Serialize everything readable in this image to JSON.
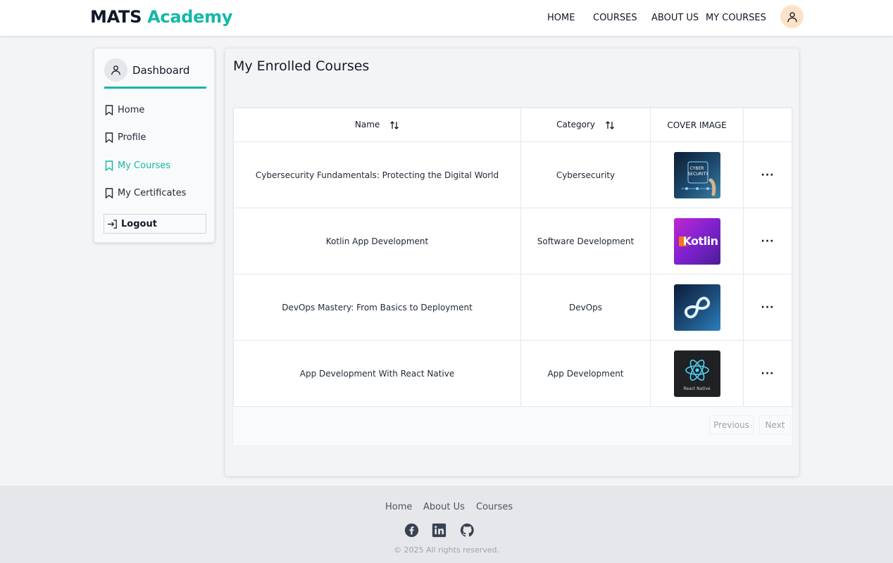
{
  "header": {
    "logo_part1": "MATS",
    "logo_part2": "Academy",
    "nav": [
      "HOME",
      "COURSES",
      "ABOUT US",
      "MY COURSES"
    ]
  },
  "sidebar": {
    "title": "Dashboard",
    "items": [
      {
        "label": "Home",
        "icon": "bookmark-icon",
        "active": false
      },
      {
        "label": "Profile",
        "icon": "bookmark-icon",
        "active": false
      },
      {
        "label": "My Courses",
        "icon": "bookmark-icon",
        "active": true
      },
      {
        "label": "My Certificates",
        "icon": "bookmark-icon",
        "active": false
      }
    ],
    "logout_label": "Logout"
  },
  "main": {
    "title": "My Enrolled Courses",
    "table": {
      "headers": [
        "Name",
        "Category",
        "COVER IMAGE",
        ""
      ],
      "rows": [
        {
          "name": "Cybersecurity Fundamentals: Protecting the Digital World",
          "category": "Cybersecurity",
          "cover": "cybersecurity-cover",
          "cover_text": "CYBER SECURITY"
        },
        {
          "name": "Kotlin App Development",
          "category": "Software Development",
          "cover": "kotlin-cover",
          "cover_text": "Kotlin"
        },
        {
          "name": "DevOps Mastery: From Basics to Deployment",
          "category": "DevOps",
          "cover": "devops-cover",
          "cover_text": ""
        },
        {
          "name": "App Development With React Native",
          "category": "App Development",
          "cover": "react-native-cover",
          "cover_text": "React Native"
        }
      ],
      "actions_label": "···"
    },
    "pagination": {
      "previous": "Previous",
      "next": "Next"
    }
  },
  "footer": {
    "links": [
      "Home",
      "About Us",
      "Courses"
    ],
    "social_icons": [
      "facebook-icon",
      "linkedin-icon",
      "github-icon"
    ],
    "copyright": "© 2025 All rights reserved."
  },
  "colors": {
    "accent": "#14b8a6",
    "background": "#f3f4f6",
    "footer": "#e5e7eb"
  }
}
